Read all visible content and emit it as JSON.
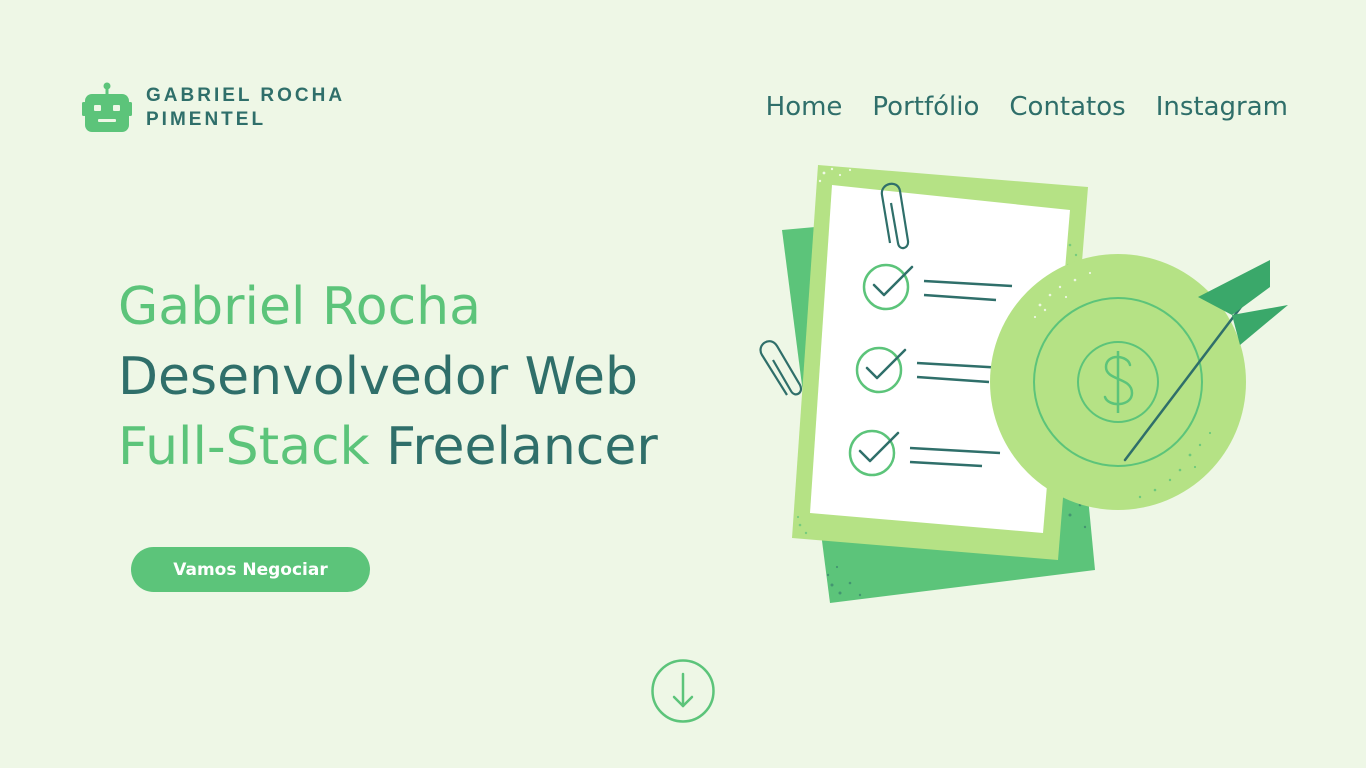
{
  "brand": {
    "icon": "robot-icon",
    "name_line1": "GABRIEL ROCHA",
    "name_line2": "PIMENTEL"
  },
  "nav": {
    "items": [
      {
        "label": "Home"
      },
      {
        "label": "Portfólio"
      },
      {
        "label": "Contatos"
      },
      {
        "label": "Instagram"
      }
    ]
  },
  "hero": {
    "line1": "Gabriel Rocha",
    "line2": "Desenvolvedor Web",
    "line3_highlight": "Full-Stack",
    "line3_rest": " Freelancer"
  },
  "cta": {
    "label": "Vamos Negociar"
  },
  "scroll": {
    "icon": "arrow-down-circle-icon"
  },
  "illustration": {
    "icons": [
      "checklist-icon",
      "target-icon",
      "dollar-icon",
      "arrow-icon",
      "paperclip-icon"
    ]
  },
  "colors": {
    "background": "#eef7e6",
    "accent_green": "#5cc47a",
    "text_teal": "#2f6f6a",
    "light_green": "#b5e285"
  }
}
